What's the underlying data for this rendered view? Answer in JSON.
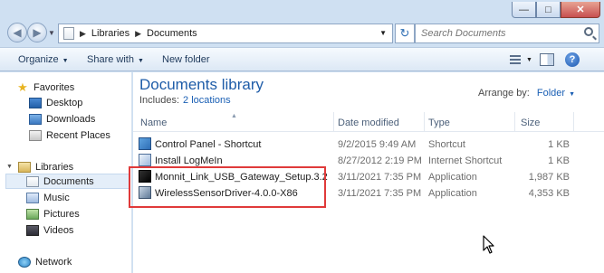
{
  "window": {
    "minimize": "—",
    "maximize": "□",
    "close": "✕"
  },
  "address": {
    "crumbs": [
      "Libraries",
      "Documents"
    ],
    "search_placeholder": "Search Documents"
  },
  "toolbar": {
    "organize": "Organize",
    "share_with": "Share with",
    "new_folder": "New folder"
  },
  "nav": {
    "favorites": "Favorites",
    "desktop": "Desktop",
    "downloads": "Downloads",
    "recent_places": "Recent Places",
    "libraries": "Libraries",
    "documents": "Documents",
    "music": "Music",
    "pictures": "Pictures",
    "videos": "Videos",
    "network": "Network"
  },
  "library": {
    "title": "Documents library",
    "includes_label": "Includes:",
    "includes_link": "2 locations",
    "arrange_label": "Arrange by:",
    "arrange_value": "Folder"
  },
  "columns": {
    "name": "Name",
    "date": "Date modified",
    "type": "Type",
    "size": "Size"
  },
  "files": [
    {
      "name": "Control Panel - Shortcut",
      "date": "9/2/2015 9:49 AM",
      "type": "Shortcut",
      "size": "1 KB"
    },
    {
      "name": "Install LogMeIn",
      "date": "8/27/2012 2:19 PM",
      "type": "Internet Shortcut",
      "size": "1 KB"
    },
    {
      "name": "Monnit_Link_USB_Gateway_Setup.3.2",
      "date": "3/11/2021 7:35 PM",
      "type": "Application",
      "size": "1,987 KB"
    },
    {
      "name": "WirelessSensorDriver-4.0.0-X86",
      "date": "3/11/2021 7:35 PM",
      "type": "Application",
      "size": "4,353 KB"
    }
  ],
  "colors": {
    "accent": "#1e5ca8",
    "highlight": "#e03a3a"
  }
}
